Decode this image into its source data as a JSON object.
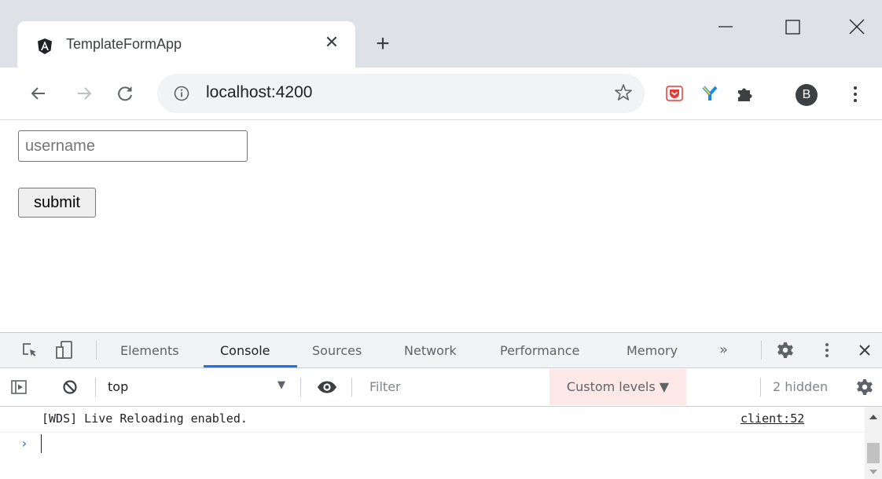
{
  "browser": {
    "tab": {
      "title": "TemplateFormApp",
      "favicon": "angular-logo-icon"
    },
    "address": {
      "url": "localhost:4200"
    },
    "profile_initial": "B",
    "accent": "#1a73e8"
  },
  "page": {
    "username": {
      "placeholder": "username",
      "value": ""
    },
    "submit_label": "submit"
  },
  "devtools": {
    "tabs": [
      "Elements",
      "Console",
      "Sources",
      "Network",
      "Performance",
      "Memory"
    ],
    "active_tab": "Console",
    "more_tabs": "»",
    "context": "top",
    "filter_placeholder": "Filter",
    "levels_label": "Custom levels ▼",
    "hidden_label": "2 hidden",
    "messages": [
      {
        "text": "[WDS] Live Reloading enabled.",
        "source": "client:52"
      }
    ],
    "prompt_symbol": "›"
  }
}
